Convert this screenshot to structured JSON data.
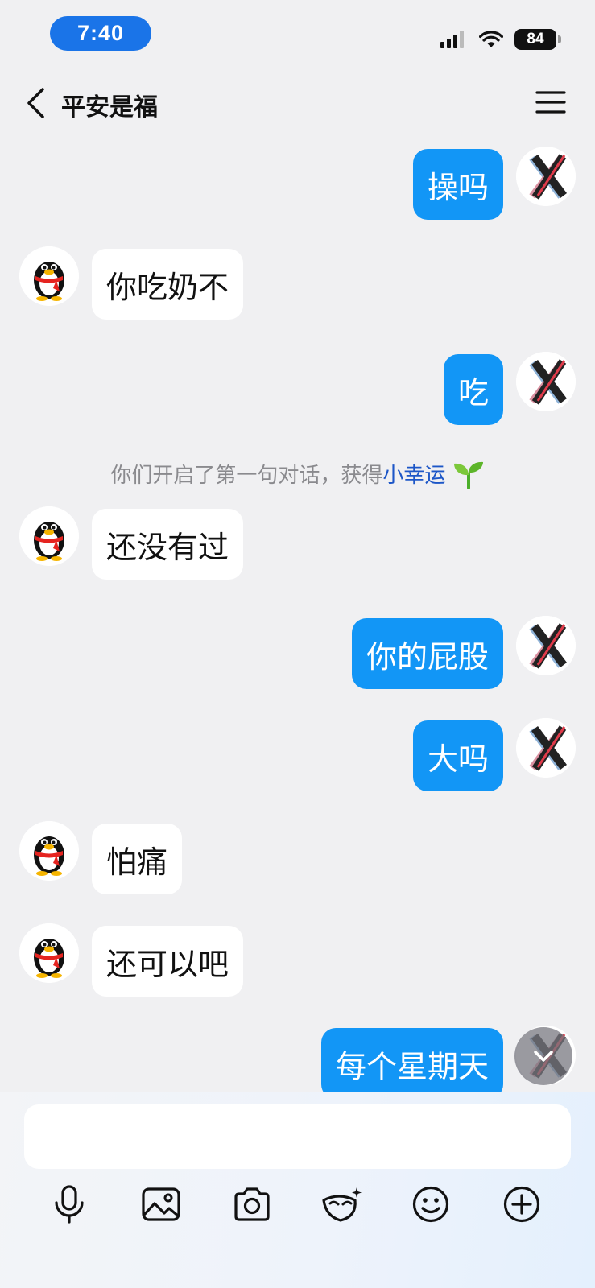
{
  "status_bar": {
    "time": "7:40",
    "battery": "84"
  },
  "header": {
    "title": "平安是福"
  },
  "messages": [
    {
      "dir": "out",
      "text": "操吗"
    },
    {
      "dir": "in",
      "text": "你吃奶不"
    },
    {
      "dir": "out",
      "text": "吃"
    },
    {
      "dir": "in",
      "text": "还没有过"
    },
    {
      "dir": "out",
      "text": "你的屁股"
    },
    {
      "dir": "out",
      "text": "大吗"
    },
    {
      "dir": "in",
      "text": "怕痛"
    },
    {
      "dir": "in",
      "text": "还可以吧"
    },
    {
      "dir": "out",
      "text": "每个星期天"
    }
  ],
  "system_message": {
    "text": "你们开启了第一句对话，获得",
    "highlight": "小幸运"
  },
  "composer": {
    "input_value": "",
    "tools": [
      "mic-icon",
      "image-icon",
      "camera-icon",
      "mask-sticker-icon",
      "emoji-icon",
      "plus-icon"
    ]
  },
  "colors": {
    "outgoing_bubble": "#1296f6",
    "incoming_bubble": "#ffffff",
    "background": "#f0f0f2",
    "link": "#1c56c7"
  }
}
